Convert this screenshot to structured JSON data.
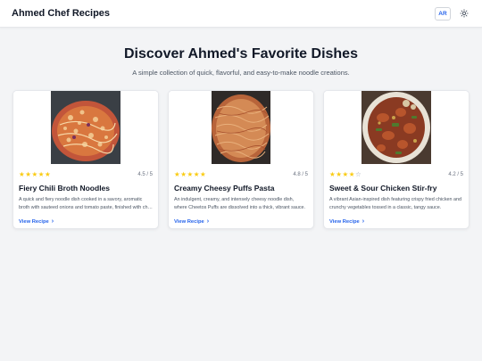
{
  "header": {
    "brand": "Ahmed Chef Recipes",
    "lang_label": "AR",
    "theme_icon": "sun-icon"
  },
  "hero": {
    "title": "Discover Ahmed's Favorite Dishes",
    "subtitle": "A simple collection of quick, flavorful, and easy-to-make noodle creations."
  },
  "colors": {
    "accent": "#2563eb",
    "star": "#facc15",
    "background": "#f3f4f6"
  },
  "recipes": [
    {
      "title": "Fiery Chili Broth Noodles",
      "rating": 4.5,
      "rating_text": "4.5 / 5",
      "description": "A quick and fiery noodle dish cooked in a savory, aromatic broth with sauteed onions and tomato paste, finished with chili flakes.",
      "link": "View Recipe"
    },
    {
      "title": "Creamy Cheesy Puffs Pasta",
      "rating": 4.8,
      "rating_text": "4.8 / 5",
      "description": "An indulgent, creamy, and intensely cheesy noodle dish, where Cheetos Puffs are dissolved into a thick, vibrant sauce.",
      "link": "View Recipe"
    },
    {
      "title": "Sweet & Sour Chicken Stir-fry",
      "rating": 4.2,
      "rating_text": "4.2 / 5",
      "description": "A vibrant Asian-inspired dish featuring crispy fried chicken and crunchy vegetables tossed in a classic, tangy sauce.",
      "link": "View Recipe"
    }
  ]
}
